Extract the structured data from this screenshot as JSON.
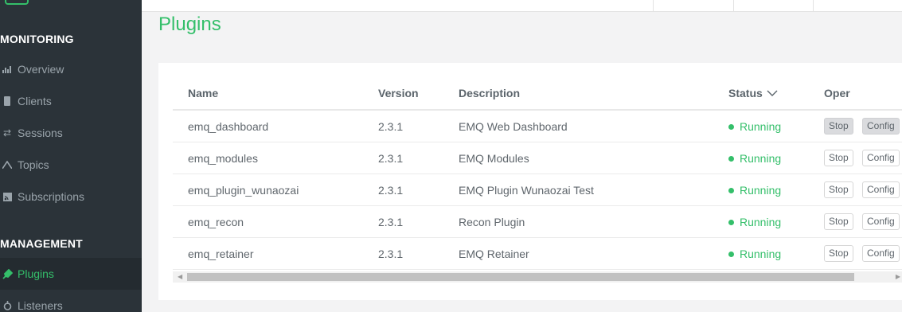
{
  "sidebar": {
    "sections": [
      {
        "title": "MONITORING"
      },
      {
        "title": "MANAGEMENT"
      }
    ],
    "items": [
      {
        "label": "Overview",
        "icon": "bar-chart-icon"
      },
      {
        "label": "Clients",
        "icon": "clients-icon"
      },
      {
        "label": "Sessions",
        "icon": "sessions-icon"
      },
      {
        "label": "Topics",
        "icon": "topics-icon"
      },
      {
        "label": "Subscriptions",
        "icon": "subscriptions-icon"
      },
      {
        "label": "Plugins",
        "icon": "plug-icon"
      },
      {
        "label": "Listeners",
        "icon": "listeners-icon"
      }
    ],
    "active": "Plugins"
  },
  "page": {
    "title": "Plugins"
  },
  "table": {
    "headers": {
      "name": "Name",
      "version": "Version",
      "description": "Description",
      "status": "Status",
      "oper": "Oper"
    },
    "rows": [
      {
        "name": "emq_dashboard",
        "version": "2.3.1",
        "description": "EMQ Web Dashboard",
        "status": "Running",
        "stop": "Stop",
        "config": "Config"
      },
      {
        "name": "emq_modules",
        "version": "2.3.1",
        "description": "EMQ Modules",
        "status": "Running",
        "stop": "Stop",
        "config": "Config"
      },
      {
        "name": "emq_plugin_wunaozai",
        "version": "2.3.1",
        "description": "EMQ Plugin Wunaozai Test",
        "status": "Running",
        "stop": "Stop",
        "config": "Config"
      },
      {
        "name": "emq_recon",
        "version": "2.3.1",
        "description": "Recon Plugin",
        "status": "Running",
        "stop": "Stop",
        "config": "Config"
      },
      {
        "name": "emq_retainer",
        "version": "2.3.1",
        "description": "EMQ Retainer",
        "status": "Running",
        "stop": "Stop",
        "config": "Config"
      }
    ]
  },
  "colors": {
    "accent": "#34bf6a",
    "sidebar_bg": "#2b3339"
  }
}
